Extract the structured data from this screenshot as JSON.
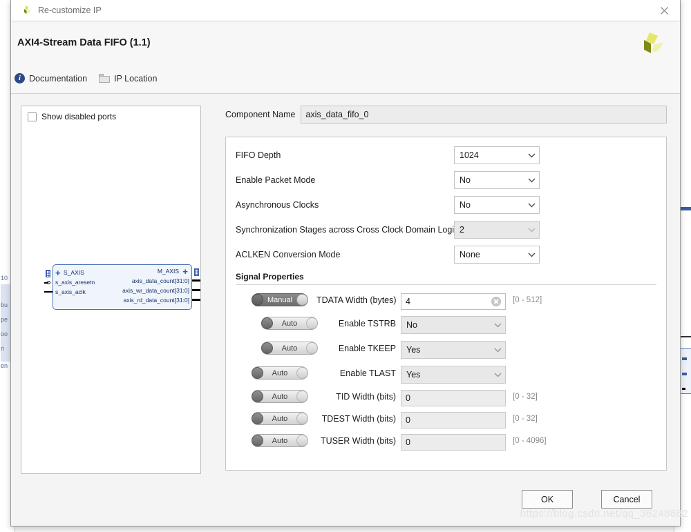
{
  "window": {
    "title": "Re-customize IP",
    "close_icon": "close-icon",
    "app_icon": "xilinx-logo-icon"
  },
  "header": {
    "ip_title": "AXI4-Stream Data FIFO (1.1)",
    "logo_icon": "xilinx-logo-icon",
    "links": [
      {
        "label": "Documentation",
        "icon": "info-icon"
      },
      {
        "label": "IP Location",
        "icon": "folder-icon"
      }
    ]
  },
  "port_panel": {
    "show_disabled_ports": {
      "label": "Show disabled ports",
      "checked": false
    },
    "block": {
      "left_bus": "S_AXIS",
      "right_bus": "M_AXIS",
      "left_ports": [
        "s_axis_aresetn",
        "s_axis_aclk"
      ],
      "right_ports": [
        "axis_data_count[31:0]",
        "axis_wr_data_count[31:0]",
        "axis_rd_data_count[31:0]"
      ]
    }
  },
  "component": {
    "label": "Component Name",
    "value": "axis_data_fifo_0"
  },
  "properties": [
    {
      "label": "FIFO Depth",
      "value": "1024",
      "disabled": false
    },
    {
      "label": "Enable Packet Mode",
      "value": "No",
      "disabled": false
    },
    {
      "label": "Asynchronous Clocks",
      "value": "No",
      "disabled": false
    },
    {
      "label": "Synchronization Stages across Cross Clock Domain Logic",
      "value": "2",
      "disabled": true
    },
    {
      "label": "ACLKEN Conversion Mode",
      "value": "None",
      "disabled": false
    }
  ],
  "signal_properties": {
    "heading": "Signal Properties",
    "rows": [
      {
        "mode": "Manual",
        "label": "TDATA Width (bytes)",
        "control": "text",
        "value": "4",
        "range": "[0 - 512]",
        "readonly": false,
        "clearable": true
      },
      {
        "mode": "Auto",
        "label": "Enable TSTRB",
        "control": "dropdown",
        "value": "No",
        "range": "",
        "readonly": true,
        "clearable": false
      },
      {
        "mode": "Auto",
        "label": "Enable TKEEP",
        "control": "dropdown",
        "value": "Yes",
        "range": "",
        "readonly": true,
        "clearable": false
      },
      {
        "mode": "Auto",
        "label": "Enable TLAST",
        "control": "dropdown",
        "value": "Yes",
        "range": "",
        "readonly": true,
        "clearable": false
      },
      {
        "mode": "Auto",
        "label": "TID Width (bits)",
        "control": "text",
        "value": "0",
        "range": "[0 - 32]",
        "readonly": true,
        "clearable": false
      },
      {
        "mode": "Auto",
        "label": "TDEST Width (bits)",
        "control": "text",
        "value": "0",
        "range": "[0 - 32]",
        "readonly": true,
        "clearable": false
      },
      {
        "mode": "Auto",
        "label": "TUSER Width (bits)",
        "control": "text",
        "value": "0",
        "range": "[0 - 4096]",
        "readonly": true,
        "clearable": false
      }
    ]
  },
  "footer": {
    "ok_label": "OK",
    "cancel_label": "Cancel"
  },
  "watermark": "https://blog.csdn.net/qq_36248682",
  "colors": {
    "accent_blue": "#2e4a86",
    "block_border": "#4a6fb5",
    "block_fill": "#f0f4fb",
    "logo_light": "#e3e86a",
    "logo_dark": "#7f8a16",
    "dialog_bg": "#f4f4f4"
  }
}
